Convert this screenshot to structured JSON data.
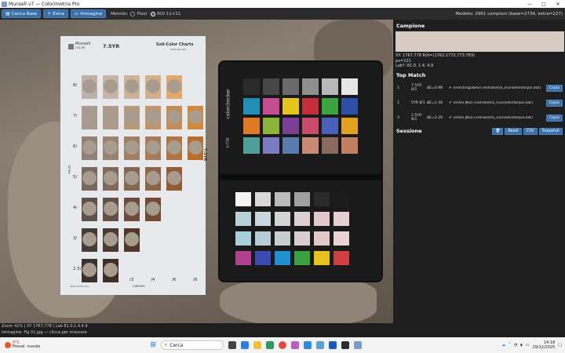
{
  "window": {
    "title": "Munsell v7 — Colorimetria Pro",
    "controls": [
      "—",
      "□",
      "✕"
    ]
  },
  "toolbar": {
    "load_base_label": "Carica Base",
    "add_label": "Extra",
    "image_label": "Immagine",
    "method_label": "Metodo:",
    "pixel_label": "Pixel",
    "roi_label": "ROI 11×11",
    "selected_method": "ROI 11×11",
    "model_info": "Modello: 2961 campioni (base=2734, extra=227)"
  },
  "photo": {
    "soil_chart": {
      "hue": "7.5YR",
      "title": "Soil-Color Charts",
      "brand": "Munsell",
      "brand_sub": "COLOR",
      "edition": "2009 Revised",
      "footer": "2022 Production",
      "value_axis": "VALUE",
      "chroma_axis": "CHROMA",
      "values": [
        "8/",
        "7/",
        "6/",
        "5/",
        "4/",
        "3/",
        "2.5/"
      ],
      "chromas": [
        "/1",
        "/2",
        "/3",
        "/4",
        "/6",
        "/8"
      ],
      "side_tab": "7.5YR"
    },
    "colorchecker": {
      "brand": "colorchecker",
      "maker": "x·rite"
    }
  },
  "sample": {
    "heading": "Campione",
    "swatch_color": "#d6ccc4",
    "xy_line": "XY: 1767,778  ROI=(1762:1772,773:783)",
    "px_line": "px=121",
    "lab_line": "Lab*: 81.0, 1.4, 4.9"
  },
  "top_match": {
    "heading": "Top Match",
    "copy_label": "Copia",
    "rows": [
      {
        "n": "1",
        "code": "7.5YR 8/1",
        "de": "ΔE=0.98",
        "verdict": "(indistinguibile)",
        "source": "[extraextra_munsellinterpol.dat]"
      },
      {
        "n": "2",
        "code": "5YR 8/1",
        "de": "ΔE=1.46",
        "verdict": "(entro JND)",
        "source": "[extraextra_munsellinterpol.dat]"
      },
      {
        "n": "3",
        "code": "2.5YR 8/1",
        "de": "ΔE=2.26",
        "verdict": "(entro JND)",
        "source": "[extraextra_munsellinterpol.dat]"
      }
    ]
  },
  "session": {
    "heading": "Sessione",
    "reset_label": "Reset",
    "csv_label": "CSV",
    "snapshot_label": "Snapshot"
  },
  "status": {
    "line1": "Zoom 42% | XY 1767,778 | Lab 81.0,1.4,4.9",
    "line2": "Immagine: Fig 01.jpg — clicca per misurare"
  },
  "taskbar": {
    "temp": "6°C",
    "weather": "Preval. nuvolo",
    "search_placeholder": "Cerca",
    "time": "14:18",
    "date": "29/12/2025"
  },
  "colors": {
    "accent": "#3a6fa8",
    "panel": "#1e1e1e"
  }
}
